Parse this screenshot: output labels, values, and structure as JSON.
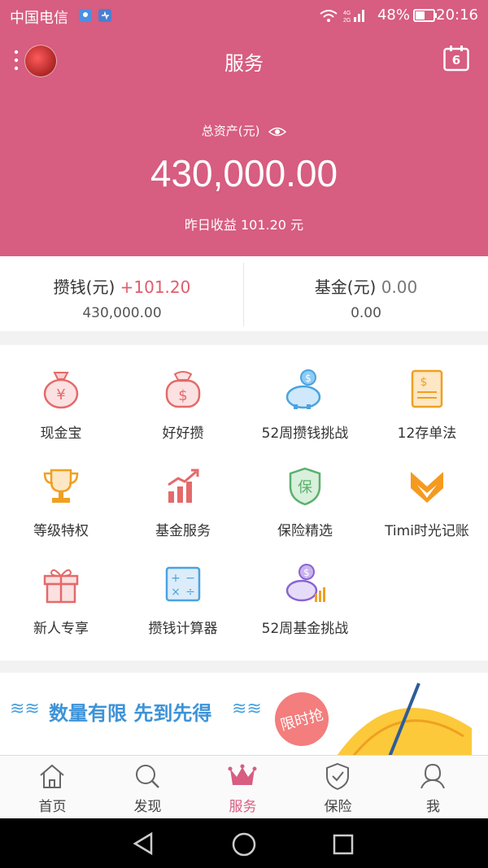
{
  "status_bar": {
    "carrier": "中国电信",
    "battery": "48%",
    "time": "20:16"
  },
  "header": {
    "title": "服务",
    "calendar_day": "6",
    "assets_label": "总资产(元)",
    "assets_value": "430,000.00",
    "yesterday": "昨日收益 101.20 元"
  },
  "summary": {
    "save": {
      "label": "攒钱(元)",
      "delta": "+101.20",
      "amount": "430,000.00"
    },
    "fund": {
      "label": "基金(元)",
      "delta": "0.00",
      "amount": "0.00"
    }
  },
  "services": [
    {
      "label": "现金宝",
      "icon": "money-bag-yen-icon"
    },
    {
      "label": "好好攒",
      "icon": "money-bag-dollar-icon"
    },
    {
      "label": "52周攒钱挑战",
      "icon": "piggy-bank-icon"
    },
    {
      "label": "12存单法",
      "icon": "document-dollar-icon"
    },
    {
      "label": "等级特权",
      "icon": "trophy-icon"
    },
    {
      "label": "基金服务",
      "icon": "chart-up-icon"
    },
    {
      "label": "保险精选",
      "icon": "shield-insurance-icon"
    },
    {
      "label": "Timi时光记账",
      "icon": "fox-logo-icon"
    },
    {
      "label": "新人专享",
      "icon": "gift-icon"
    },
    {
      "label": "攒钱计算器",
      "icon": "calculator-icon"
    },
    {
      "label": "52周基金挑战",
      "icon": "piggy-chart-icon"
    }
  ],
  "banner": {
    "headline": "数量有限 先到先得",
    "stamp": "限时抢"
  },
  "tabs": [
    {
      "label": "首页",
      "icon": "home-icon"
    },
    {
      "label": "发现",
      "icon": "search-icon"
    },
    {
      "label": "服务",
      "icon": "crown-icon"
    },
    {
      "label": "保险",
      "icon": "shield-check-icon"
    },
    {
      "label": "我",
      "icon": "person-icon"
    }
  ],
  "colors": {
    "brand": "#d75d81",
    "accent_red": "#e05c6d",
    "blue": "#3d93d9"
  }
}
